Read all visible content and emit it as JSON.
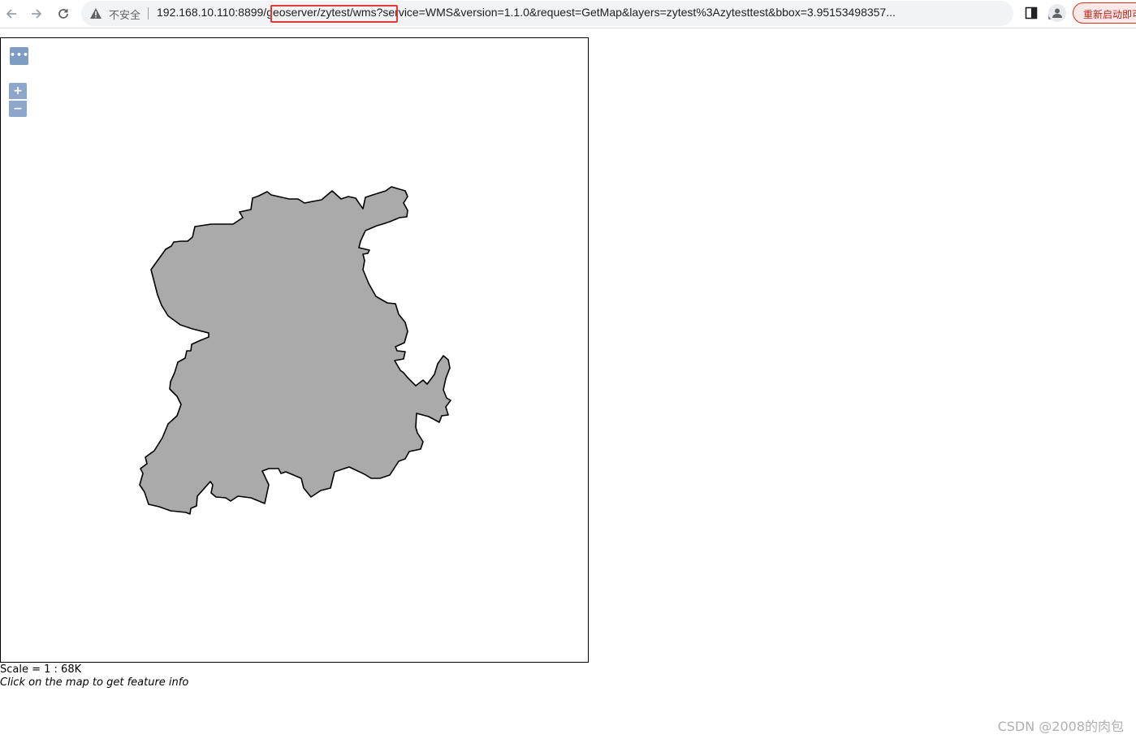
{
  "browser": {
    "security_label": "不安全",
    "url_host": "192.168.10.110:8899/",
    "url_path": "geoserver/zytest/wms",
    "url_query": "?service=WMS&version=1.1.0&request=GetMap&layers=zytest%3Azytesttest&bbox=3.95153498357...",
    "relaunch_label": "重新启动即可",
    "icons": [
      "back-icon",
      "forward-icon",
      "reload-icon",
      "warning-icon",
      "share-icon",
      "star-icon",
      "side-panel-icon",
      "profile-icon"
    ]
  },
  "map": {
    "toolbar_toggle": "•••",
    "zoom_in": "+",
    "zoom_out": "−",
    "polygon_fill": "#aaaaaa",
    "polygon_stroke": "#000000",
    "control_color": "#7b9cc4"
  },
  "footer": {
    "scale": "Scale = 1 : 68K",
    "hint": "Click on the map to get feature info"
  },
  "watermark": "CSDN @2008的肉包"
}
